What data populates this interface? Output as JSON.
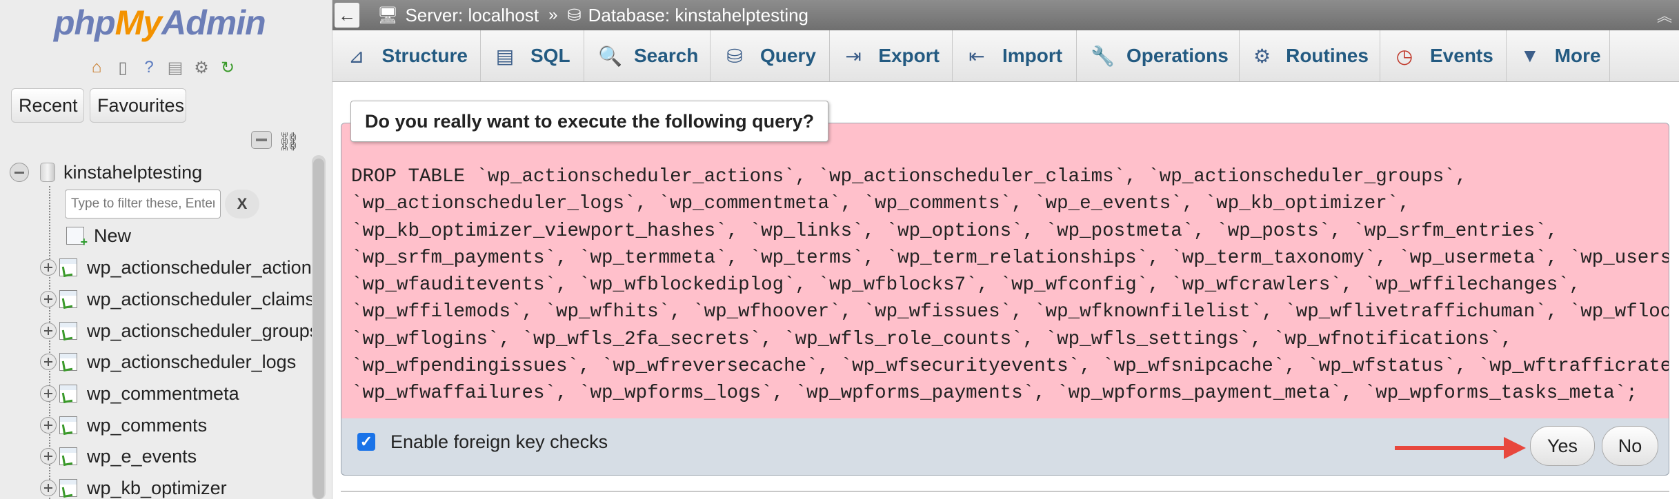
{
  "logo": {
    "php": "php",
    "my": "My",
    "admin": "Admin"
  },
  "quick_icons": [
    "home-icon",
    "exit-icon",
    "help-icon",
    "docs-icon",
    "settings-icon",
    "reload-icon"
  ],
  "sidebar": {
    "recent_label": "Recent",
    "favourites_label": "Favourites",
    "database": "kinstahelptesting",
    "filter_placeholder": "Type to filter these, Enter to search all",
    "filter_clear": "X",
    "new_label": "New",
    "tables": [
      "wp_actionscheduler_actions",
      "wp_actionscheduler_claims",
      "wp_actionscheduler_groups",
      "wp_actionscheduler_logs",
      "wp_commentmeta",
      "wp_comments",
      "wp_e_events",
      "wp_kb_optimizer"
    ]
  },
  "topbar": {
    "back": "←",
    "server": "Server: localhost",
    "separator": "»",
    "database": "Database: kinstahelptesting"
  },
  "tabs": [
    {
      "label": "Structure",
      "icon": "structure-icon"
    },
    {
      "label": "SQL",
      "icon": "sql-icon"
    },
    {
      "label": "Search",
      "icon": "search-icon"
    },
    {
      "label": "Query",
      "icon": "query-icon"
    },
    {
      "label": "Export",
      "icon": "export-icon"
    },
    {
      "label": "Import",
      "icon": "import-icon"
    },
    {
      "label": "Operations",
      "icon": "operations-icon"
    },
    {
      "label": "Routines",
      "icon": "routines-icon"
    },
    {
      "label": "Events",
      "icon": "events-icon"
    },
    {
      "label": "More",
      "icon": "more-icon"
    }
  ],
  "confirm": {
    "question": "Do you really want to execute the following query?",
    "query_lines": [
      "DROP TABLE `wp_actionscheduler_actions`, `wp_actionscheduler_claims`, `wp_actionscheduler_groups`,",
      "`wp_actionscheduler_logs`, `wp_commentmeta`, `wp_comments`, `wp_e_events`, `wp_kb_optimizer`,",
      "`wp_kb_optimizer_viewport_hashes`, `wp_links`, `wp_options`, `wp_postmeta`, `wp_posts`, `wp_srfm_entries`,",
      "`wp_srfm_payments`, `wp_termmeta`, `wp_terms`, `wp_term_relationships`, `wp_term_taxonomy`, `wp_usermeta`, `wp_users`,",
      "`wp_wfauditevents`, `wp_wfblockediplog`, `wp_wfblocks7`, `wp_wfconfig`, `wp_wfcrawlers`, `wp_wffilechanges`,",
      "`wp_wffilemods`, `wp_wfhits`, `wp_wfhoover`, `wp_wfissues`, `wp_wfknownfilelist`, `wp_wflivetraffichuman`, `wp_wflocs`,",
      "`wp_wflogins`, `wp_wfls_2fa_secrets`, `wp_wfls_role_counts`, `wp_wfls_settings`, `wp_wfnotifications`,",
      "`wp_wfpendingissues`, `wp_wfreversecache`, `wp_wfsecurityevents`, `wp_wfsnipcache`, `wp_wfstatus`, `wp_wftrafficrates`,",
      "`wp_wfwaffailures`, `wp_wpforms_logs`, `wp_wpforms_payments`, `wp_wpforms_payment_meta`, `wp_wpforms_tasks_meta`;"
    ],
    "fk_checks_label": "Enable foreign key checks",
    "fk_checks_checked": true,
    "yes_label": "Yes",
    "no_label": "No"
  },
  "colors": {
    "query_bg": "#ffc0cb",
    "annotation_arrow": "#e8473d",
    "tab_text": "#235a81"
  }
}
